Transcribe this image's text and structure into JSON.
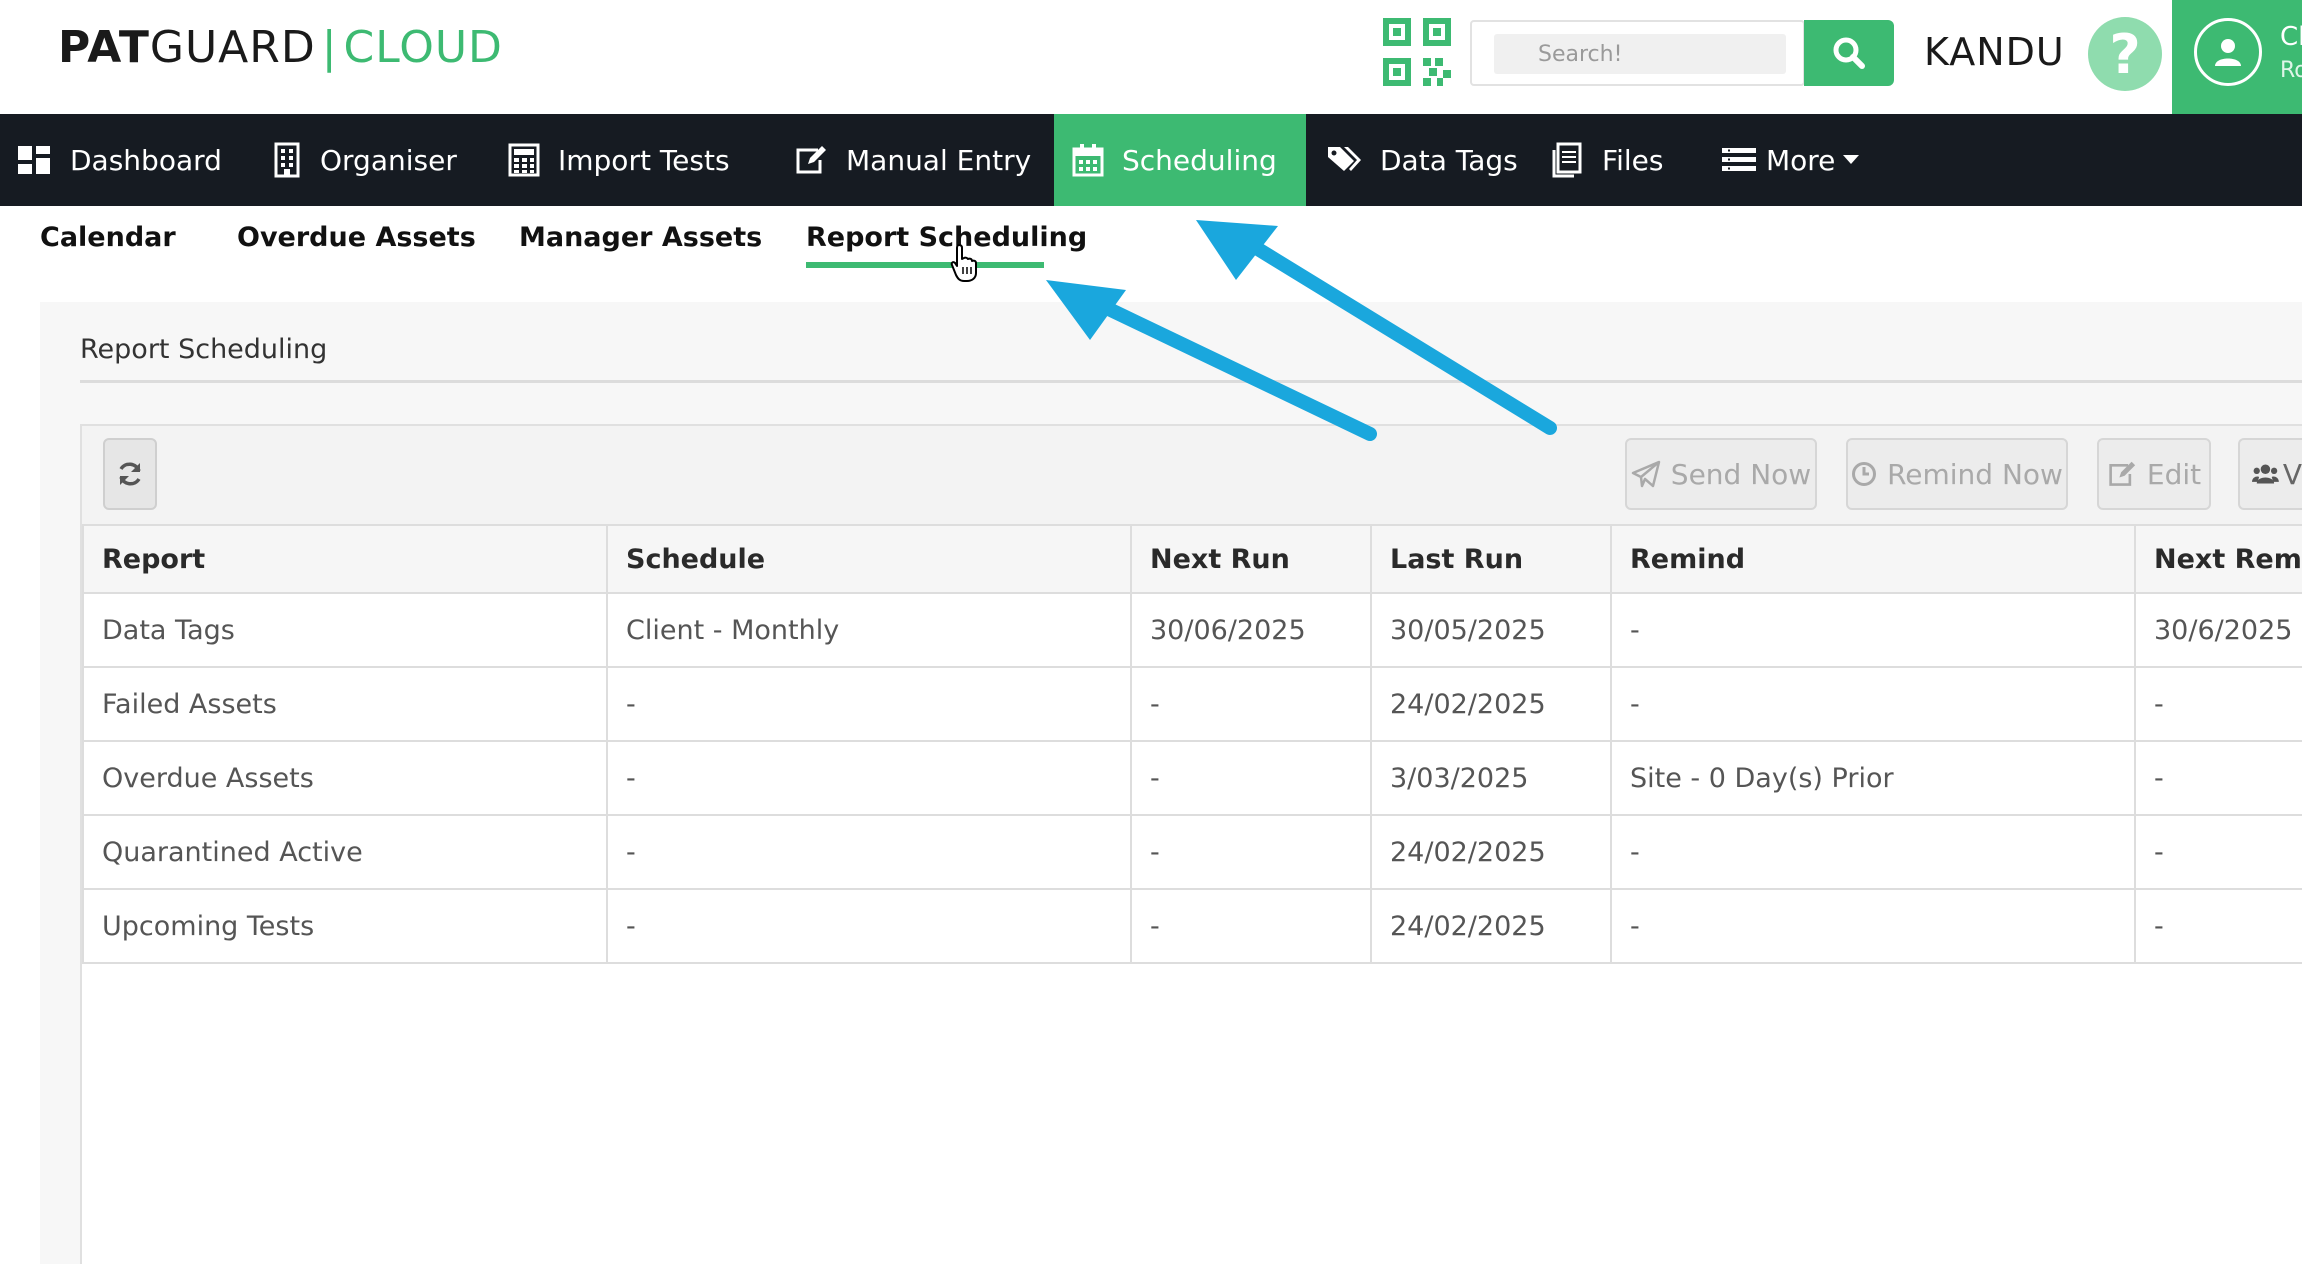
{
  "header": {
    "logo_pat": "PAT",
    "logo_guard": "GUARD",
    "logo_sep": "|",
    "logo_cloud": "CLOUD",
    "search_placeholder": "Search!",
    "org_name": "KANDU",
    "help_glyph": "?",
    "user_line1": "Cl",
    "user_line2": "Ro"
  },
  "nav": {
    "items": [
      {
        "label": "Dashboard",
        "icon": "dashboard-icon"
      },
      {
        "label": "Organiser",
        "icon": "building-icon"
      },
      {
        "label": "Import Tests",
        "icon": "calculator-icon"
      },
      {
        "label": "Manual Entry",
        "icon": "edit-icon"
      },
      {
        "label": "Scheduling",
        "icon": "calendar-icon",
        "active": true
      },
      {
        "label": "Data Tags",
        "icon": "tags-icon"
      },
      {
        "label": "Files",
        "icon": "files-icon"
      },
      {
        "label": "More",
        "icon": "menu-icon"
      }
    ]
  },
  "subnav": {
    "items": [
      "Calendar",
      "Overdue Assets",
      "Manager Assets",
      "Report Scheduling"
    ],
    "active_index": 3
  },
  "panel": {
    "title": "Report Scheduling"
  },
  "toolbar": {
    "send_now": "Send Now",
    "remind_now": "Remind Now",
    "edit": "Edit",
    "partial_label": "V"
  },
  "table": {
    "headers": [
      "Report",
      "Schedule",
      "Next Run",
      "Last Run",
      "Remind",
      "Next Remin"
    ],
    "rows": [
      [
        "Data Tags",
        "Client - Monthly",
        "30/06/2025",
        "30/05/2025",
        "-",
        "30/6/2025"
      ],
      [
        "Failed Assets",
        "-",
        "-",
        "24/02/2025",
        "-",
        "-"
      ],
      [
        "Overdue Assets",
        "-",
        "-",
        "3/03/2025",
        "Site - 0 Day(s) Prior",
        "-"
      ],
      [
        "Quarantined Active",
        "-",
        "-",
        "24/02/2025",
        "-",
        "-"
      ],
      [
        "Upcoming Tests",
        "-",
        "-",
        "24/02/2025",
        "-",
        "-"
      ]
    ]
  },
  "colors": {
    "brand_green": "#3dba72",
    "nav_dark": "#161b22",
    "annotation_blue": "#1aa7dd"
  }
}
